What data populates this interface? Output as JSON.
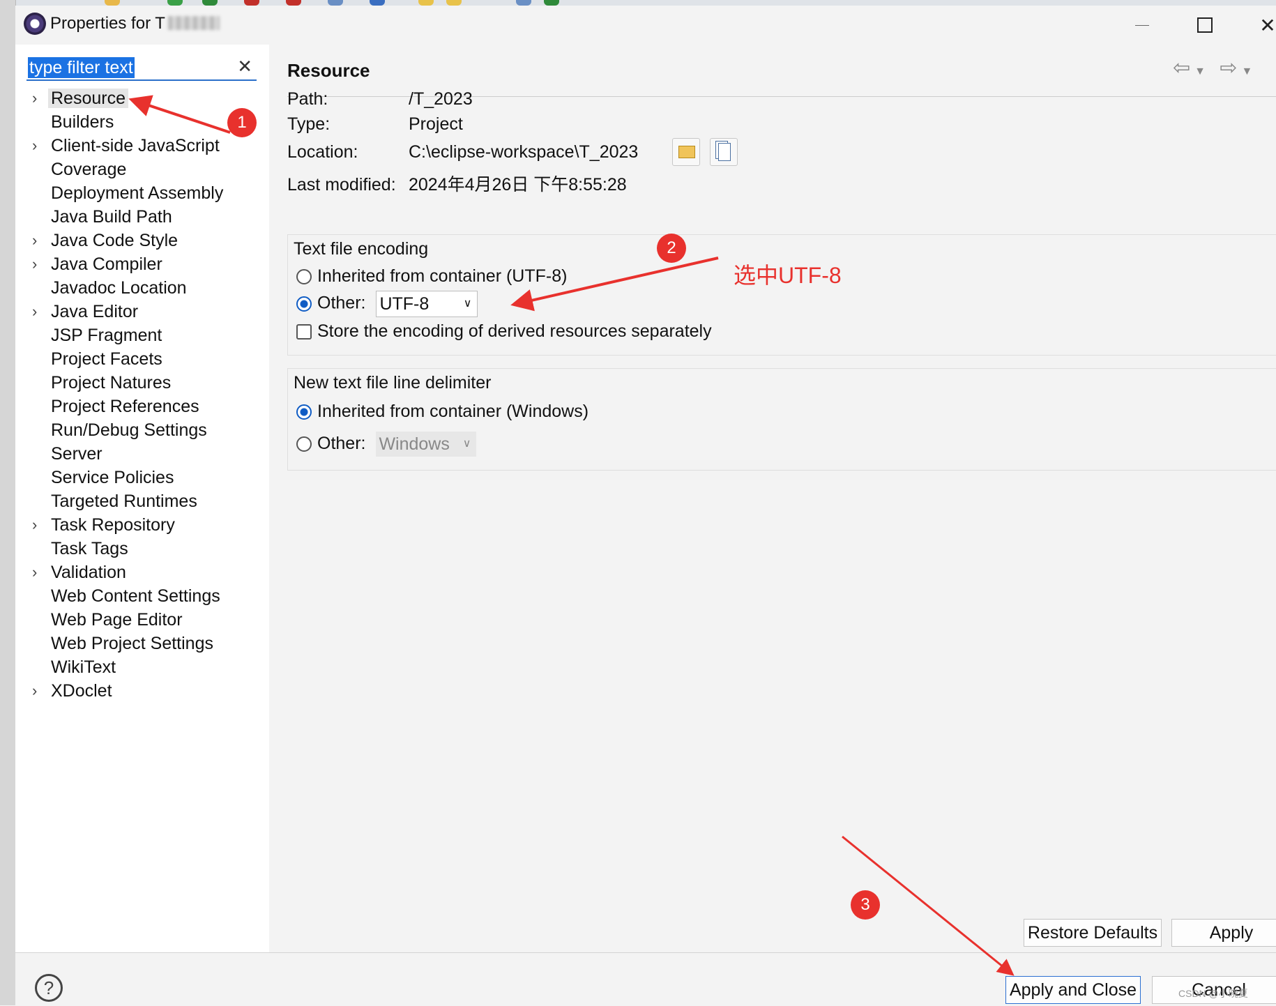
{
  "window": {
    "title": "Properties for T_2023",
    "title_visible": "Properties for T",
    "min_icon": "minimize-icon",
    "max_icon": "maximize-icon",
    "close_icon": "close-icon"
  },
  "filter": {
    "value": "type filter text",
    "clear_icon": "clear-icon"
  },
  "tree": [
    {
      "label": "Resource",
      "expandable": true,
      "selected": true
    },
    {
      "label": "Builders",
      "expandable": false
    },
    {
      "label": "Client-side JavaScript",
      "expandable": true
    },
    {
      "label": "Coverage",
      "expandable": false
    },
    {
      "label": "Deployment Assembly",
      "expandable": false
    },
    {
      "label": "Java Build Path",
      "expandable": false
    },
    {
      "label": "Java Code Style",
      "expandable": true
    },
    {
      "label": "Java Compiler",
      "expandable": true
    },
    {
      "label": "Javadoc Location",
      "expandable": false
    },
    {
      "label": "Java Editor",
      "expandable": true
    },
    {
      "label": "JSP Fragment",
      "expandable": false
    },
    {
      "label": "Project Facets",
      "expandable": false
    },
    {
      "label": "Project Natures",
      "expandable": false
    },
    {
      "label": "Project References",
      "expandable": false
    },
    {
      "label": "Run/Debug Settings",
      "expandable": false
    },
    {
      "label": "Server",
      "expandable": false
    },
    {
      "label": "Service Policies",
      "expandable": false
    },
    {
      "label": "Targeted Runtimes",
      "expandable": false
    },
    {
      "label": "Task Repository",
      "expandable": true
    },
    {
      "label": "Task Tags",
      "expandable": false
    },
    {
      "label": "Validation",
      "expandable": true
    },
    {
      "label": "Web Content Settings",
      "expandable": false
    },
    {
      "label": "Web Page Editor",
      "expandable": false
    },
    {
      "label": "Web Project Settings",
      "expandable": false
    },
    {
      "label": "WikiText",
      "expandable": false
    },
    {
      "label": "XDoclet",
      "expandable": true
    }
  ],
  "page": {
    "title": "Resource",
    "props": {
      "path_label": "Path:",
      "path_value": "/T_2023",
      "type_label": "Type:",
      "type_value": "Project",
      "location_label": "Location:",
      "location_value": "C:\\eclipse-workspace\\T_2023",
      "modified_label": "Last modified:",
      "modified_value": "2024年4月26日 下午8:55:28"
    },
    "encoding": {
      "title": "Text file encoding",
      "inherited_label": "Inherited from container (UTF-8)",
      "other_label": "Other:",
      "other_value": "UTF-8",
      "store_label": "Store the encoding of derived resources separately",
      "selected": "other"
    },
    "delimiter": {
      "title": "New text file line delimiter",
      "inherited_label": "Inherited from container (Windows)",
      "other_label": "Other:",
      "other_value": "Windows",
      "selected": "inherited"
    }
  },
  "buttons": {
    "restore": "Restore Defaults",
    "apply": "Apply",
    "apply_close": "Apply and Close",
    "cancel": "Cancel"
  },
  "annotations": {
    "badge1": "1",
    "badge2": "2",
    "badge3": "3",
    "note": "选中UTF-8",
    "color": "#e8312d",
    "watermark": "CSDN @小晓夏"
  },
  "colors": {
    "accent": "#0f5cc4",
    "selection": "#1b72e3"
  }
}
